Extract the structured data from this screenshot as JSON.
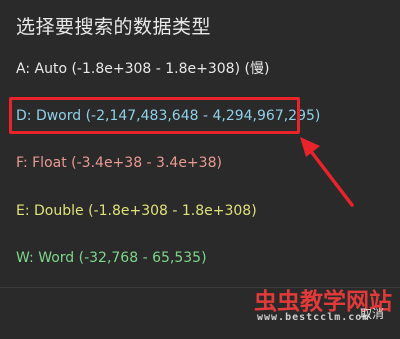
{
  "dialog": {
    "title": "选择要搜索的数据类型",
    "options": [
      {
        "label": "A: Auto (-1.8e+308 - 1.8e+308) (慢)",
        "color": "#e8e8e8"
      },
      {
        "label": "D: Dword (-2,147,483,648 - 4,294,967,295)",
        "color": "#8fd0e8"
      },
      {
        "label": "F: Float (-3.4e+38 - 3.4e+38)",
        "color": "#e89a90"
      },
      {
        "label": "E: Double (-1.8e+308 - 1.8e+308)",
        "color": "#e0e07a"
      },
      {
        "label": "W: Word (-32,768 - 65,535)",
        "color": "#7ed68a"
      }
    ],
    "cancel_label": "取消"
  },
  "annotation": {
    "highlight_color": "#e8242a",
    "arrow_color": "#e8242a"
  },
  "watermark": {
    "brand": "虫虫教学网站",
    "url": "www.bestcclm.com"
  }
}
